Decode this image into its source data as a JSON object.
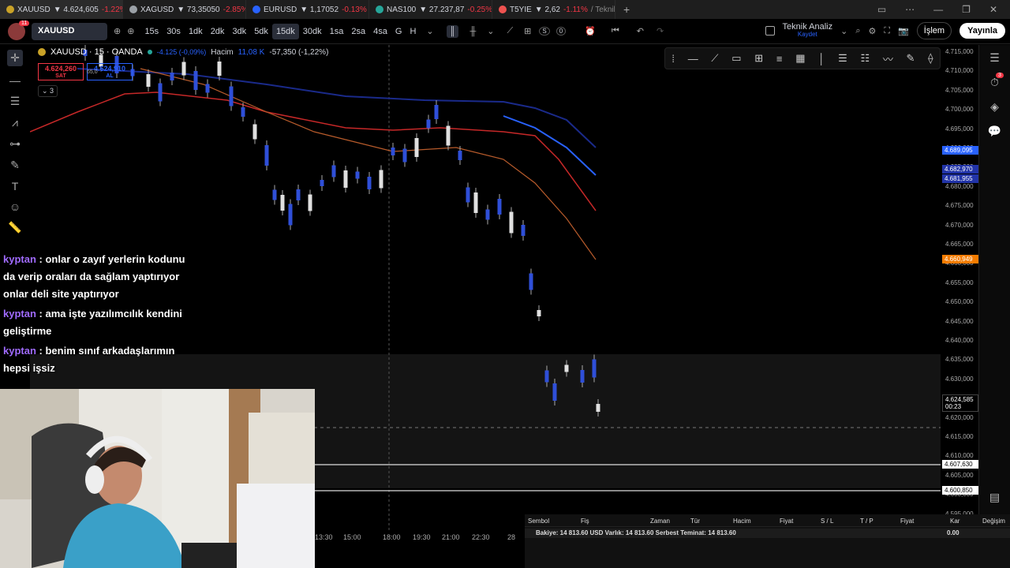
{
  "tabs": [
    {
      "symbol": "XAUUSD",
      "price": "▼ 4.624,605",
      "change": "-1.22%",
      "color": "#c9a227"
    },
    {
      "symbol": "XAGUSD",
      "price": "▼ 73,35050",
      "change": "-2.85%",
      "color": "#9aa0a6"
    },
    {
      "symbol": "EURUSD",
      "price": "▼ 1,17052",
      "change": "-0.13%",
      "color": "#2962ff"
    },
    {
      "symbol": "NAS100",
      "price": "▼ 27.237,87",
      "change": "-0.25%",
      "color": "#26a69a"
    },
    {
      "symbol": "T5YIE",
      "price": "▼ 2,62",
      "change": "-1.11%",
      "extra": "/ Teknik",
      "color": "#ef5350"
    }
  ],
  "toolbar": {
    "symbol": "XAUUSD",
    "avatar_badge": "11",
    "intervals": [
      "15s",
      "30s",
      "1dk",
      "2dk",
      "3dk",
      "5dk",
      "15dk",
      "30dk",
      "1sa",
      "2sa",
      "4sa",
      "G",
      "H"
    ],
    "active_interval": "15dk",
    "layout_name": "Teknik Analiz",
    "layout_status": "Kaydet",
    "islem_label": "İşlem",
    "yayinla_label": "Yayınla",
    "s_label": "S",
    "zero_label": "0"
  },
  "legend": {
    "title": "XAUUSD · 15 · OANDA",
    "change": "-4.125 (-0,09%)",
    "volume_label": "Hacim",
    "volume": "11,08 K",
    "volume_change": "-57,350 (-1,22%)",
    "sell_price": "4.624,260",
    "sell_label": "SAT",
    "spread": "65,0",
    "buy_price": "4.624,910",
    "buy_label": "AL",
    "indicator_count": "3"
  },
  "price_axis": {
    "ticks": [
      "4.715,000",
      "4.710,000",
      "4.705,000",
      "4.700,000",
      "4.695,000",
      "4.690,000",
      "4.685,000",
      "4.680,000",
      "4.675,000",
      "4.670,000",
      "4.665,000",
      "4.660,000",
      "4.655,000",
      "4.650,000",
      "4.645,000",
      "4.640,000",
      "4.635,000",
      "4.630,000",
      "4.625,000",
      "4.620,000",
      "4.615,000",
      "4.610,000",
      "4.605,000",
      "4.600,000",
      "4.595,000"
    ],
    "tag_blue1": "4.689,095",
    "tag_blue2": "4.682,970",
    "tag_blue3": "4.681,955",
    "tag_orange": "4.660,949",
    "tag_current": "4.624,585",
    "tag_timer": "00:23",
    "tag_line1": "4.607,630",
    "tag_line2": "4.600,850",
    "colors": {
      "blue": "#2962ff",
      "orange": "#f57c00",
      "red": "#e53935"
    }
  },
  "time_axis": [
    "13:30",
    "15:00",
    "18:00",
    "19:30",
    "21:00",
    "22:30",
    "28"
  ],
  "chat": [
    {
      "user": "kyptan",
      "text": ": onlar o zayıf yerlerin kodunu da verip oraları da sağlam yaptırıyor onlar deli site yaptırıyor"
    },
    {
      "user": "kyptan",
      "text": ": ama işte yazılımcılık kendini geliştirme"
    },
    {
      "user": "kyptan",
      "text": ": benim sınıf arkadaşlarımın hepsi işsiz"
    }
  ],
  "orders": {
    "columns": [
      "Sembol",
      "Fiş",
      "Zaman",
      "Tür",
      "Hacim",
      "Fiyat",
      "S / L",
      "T / P",
      "Fiyat",
      "Kar",
      "Değişim"
    ],
    "balance": "Bakiye: 14 813.60 USD  Varlık: 14 813.60  Serbest Teminat: 14 813.60",
    "profit": "0.00"
  },
  "right_bar_badge": "3"
}
